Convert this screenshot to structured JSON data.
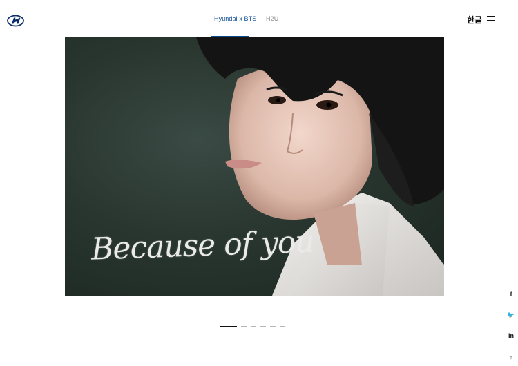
{
  "header": {
    "logo_icon": "hyundai-logo-icon",
    "tabs": [
      {
        "label": "Hyundai x BTS",
        "active": true
      },
      {
        "label": "H2U",
        "active": false
      }
    ],
    "language": "한글",
    "menu_icon": "hamburger-icon"
  },
  "hero": {
    "caption": "Because of you"
  },
  "carousel": {
    "slide_count": 6,
    "active_index": 0
  },
  "social": [
    {
      "icon": "facebook-icon",
      "glyph": "f"
    },
    {
      "icon": "twitter-icon",
      "glyph": "🐦"
    },
    {
      "icon": "linkedin-icon",
      "glyph": "in"
    },
    {
      "icon": "scroll-top-icon",
      "glyph": "↑"
    }
  ],
  "colors": {
    "accent": "#0b4a8f",
    "tab_inactive": "#8a8a8a",
    "dot_active": "#111111",
    "dot_inactive": "#b5b5b5"
  }
}
